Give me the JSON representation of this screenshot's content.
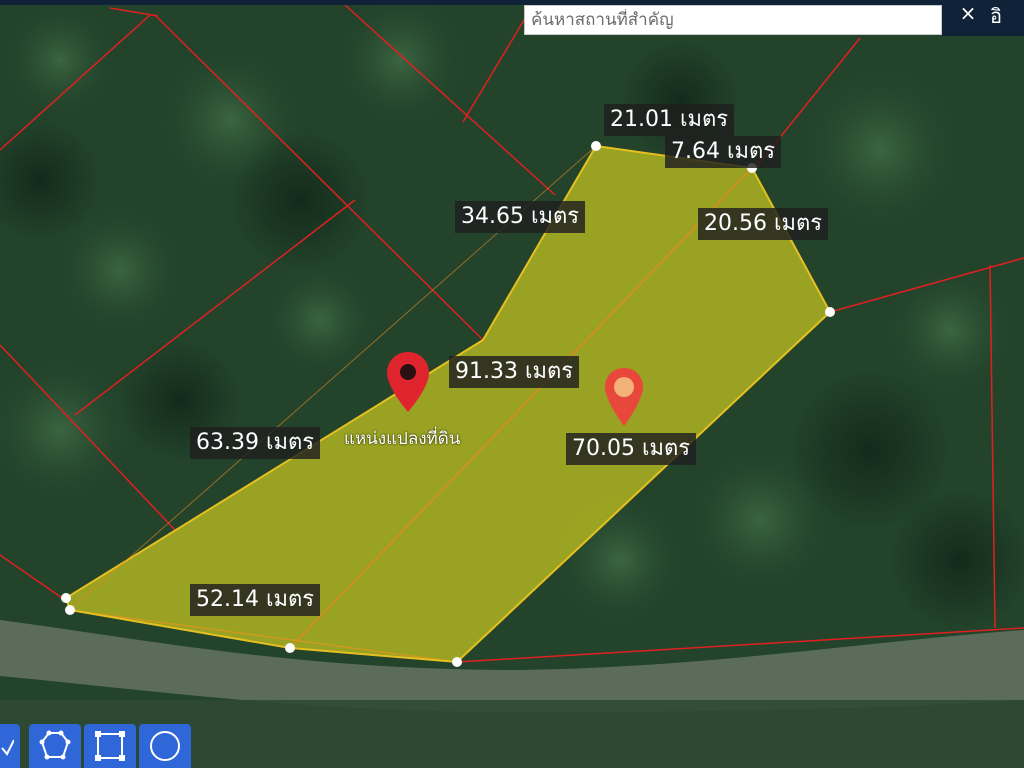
{
  "search": {
    "placeholder": "ค้นหาสถานที่สำคัญ",
    "clear_label": "×",
    "extra_label": "อิ"
  },
  "measurements": {
    "m1": "21.01 เมตร",
    "m2": "7.64 เมตร",
    "m3": "34.65 เมตร",
    "m4": "20.56 เมตร",
    "m5": "91.33 เมตร",
    "m6": "63.39 เมตร",
    "m7": "70.05 เมตร",
    "m8": "52.14 เมตร"
  },
  "pin_label": "แหน่งแปลงที่ดิน",
  "colors": {
    "parcel_fill": "#c8c81e",
    "boundary": "#e02020",
    "pin_primary": "#e0242e",
    "pin_secondary": "#e8473b",
    "tool_bg": "#2f66d8"
  },
  "tools": [
    "check-tool",
    "polygon-tool",
    "rectangle-tool",
    "circle-tool"
  ]
}
